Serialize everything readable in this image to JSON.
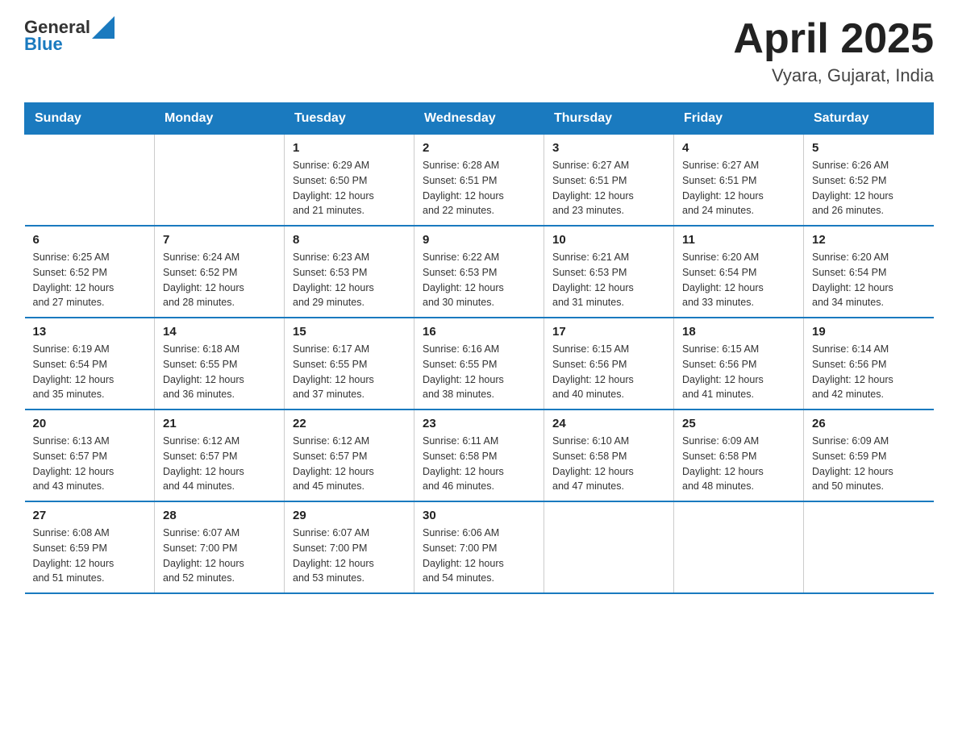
{
  "logo": {
    "text_general": "General",
    "text_blue": "Blue"
  },
  "title": "April 2025",
  "location": "Vyara, Gujarat, India",
  "days_of_week": [
    "Sunday",
    "Monday",
    "Tuesday",
    "Wednesday",
    "Thursday",
    "Friday",
    "Saturday"
  ],
  "weeks": [
    [
      {
        "day": "",
        "info": ""
      },
      {
        "day": "",
        "info": ""
      },
      {
        "day": "1",
        "info": "Sunrise: 6:29 AM\nSunset: 6:50 PM\nDaylight: 12 hours\nand 21 minutes."
      },
      {
        "day": "2",
        "info": "Sunrise: 6:28 AM\nSunset: 6:51 PM\nDaylight: 12 hours\nand 22 minutes."
      },
      {
        "day": "3",
        "info": "Sunrise: 6:27 AM\nSunset: 6:51 PM\nDaylight: 12 hours\nand 23 minutes."
      },
      {
        "day": "4",
        "info": "Sunrise: 6:27 AM\nSunset: 6:51 PM\nDaylight: 12 hours\nand 24 minutes."
      },
      {
        "day": "5",
        "info": "Sunrise: 6:26 AM\nSunset: 6:52 PM\nDaylight: 12 hours\nand 26 minutes."
      }
    ],
    [
      {
        "day": "6",
        "info": "Sunrise: 6:25 AM\nSunset: 6:52 PM\nDaylight: 12 hours\nand 27 minutes."
      },
      {
        "day": "7",
        "info": "Sunrise: 6:24 AM\nSunset: 6:52 PM\nDaylight: 12 hours\nand 28 minutes."
      },
      {
        "day": "8",
        "info": "Sunrise: 6:23 AM\nSunset: 6:53 PM\nDaylight: 12 hours\nand 29 minutes."
      },
      {
        "day": "9",
        "info": "Sunrise: 6:22 AM\nSunset: 6:53 PM\nDaylight: 12 hours\nand 30 minutes."
      },
      {
        "day": "10",
        "info": "Sunrise: 6:21 AM\nSunset: 6:53 PM\nDaylight: 12 hours\nand 31 minutes."
      },
      {
        "day": "11",
        "info": "Sunrise: 6:20 AM\nSunset: 6:54 PM\nDaylight: 12 hours\nand 33 minutes."
      },
      {
        "day": "12",
        "info": "Sunrise: 6:20 AM\nSunset: 6:54 PM\nDaylight: 12 hours\nand 34 minutes."
      }
    ],
    [
      {
        "day": "13",
        "info": "Sunrise: 6:19 AM\nSunset: 6:54 PM\nDaylight: 12 hours\nand 35 minutes."
      },
      {
        "day": "14",
        "info": "Sunrise: 6:18 AM\nSunset: 6:55 PM\nDaylight: 12 hours\nand 36 minutes."
      },
      {
        "day": "15",
        "info": "Sunrise: 6:17 AM\nSunset: 6:55 PM\nDaylight: 12 hours\nand 37 minutes."
      },
      {
        "day": "16",
        "info": "Sunrise: 6:16 AM\nSunset: 6:55 PM\nDaylight: 12 hours\nand 38 minutes."
      },
      {
        "day": "17",
        "info": "Sunrise: 6:15 AM\nSunset: 6:56 PM\nDaylight: 12 hours\nand 40 minutes."
      },
      {
        "day": "18",
        "info": "Sunrise: 6:15 AM\nSunset: 6:56 PM\nDaylight: 12 hours\nand 41 minutes."
      },
      {
        "day": "19",
        "info": "Sunrise: 6:14 AM\nSunset: 6:56 PM\nDaylight: 12 hours\nand 42 minutes."
      }
    ],
    [
      {
        "day": "20",
        "info": "Sunrise: 6:13 AM\nSunset: 6:57 PM\nDaylight: 12 hours\nand 43 minutes."
      },
      {
        "day": "21",
        "info": "Sunrise: 6:12 AM\nSunset: 6:57 PM\nDaylight: 12 hours\nand 44 minutes."
      },
      {
        "day": "22",
        "info": "Sunrise: 6:12 AM\nSunset: 6:57 PM\nDaylight: 12 hours\nand 45 minutes."
      },
      {
        "day": "23",
        "info": "Sunrise: 6:11 AM\nSunset: 6:58 PM\nDaylight: 12 hours\nand 46 minutes."
      },
      {
        "day": "24",
        "info": "Sunrise: 6:10 AM\nSunset: 6:58 PM\nDaylight: 12 hours\nand 47 minutes."
      },
      {
        "day": "25",
        "info": "Sunrise: 6:09 AM\nSunset: 6:58 PM\nDaylight: 12 hours\nand 48 minutes."
      },
      {
        "day": "26",
        "info": "Sunrise: 6:09 AM\nSunset: 6:59 PM\nDaylight: 12 hours\nand 50 minutes."
      }
    ],
    [
      {
        "day": "27",
        "info": "Sunrise: 6:08 AM\nSunset: 6:59 PM\nDaylight: 12 hours\nand 51 minutes."
      },
      {
        "day": "28",
        "info": "Sunrise: 6:07 AM\nSunset: 7:00 PM\nDaylight: 12 hours\nand 52 minutes."
      },
      {
        "day": "29",
        "info": "Sunrise: 6:07 AM\nSunset: 7:00 PM\nDaylight: 12 hours\nand 53 minutes."
      },
      {
        "day": "30",
        "info": "Sunrise: 6:06 AM\nSunset: 7:00 PM\nDaylight: 12 hours\nand 54 minutes."
      },
      {
        "day": "",
        "info": ""
      },
      {
        "day": "",
        "info": ""
      },
      {
        "day": "",
        "info": ""
      }
    ]
  ]
}
